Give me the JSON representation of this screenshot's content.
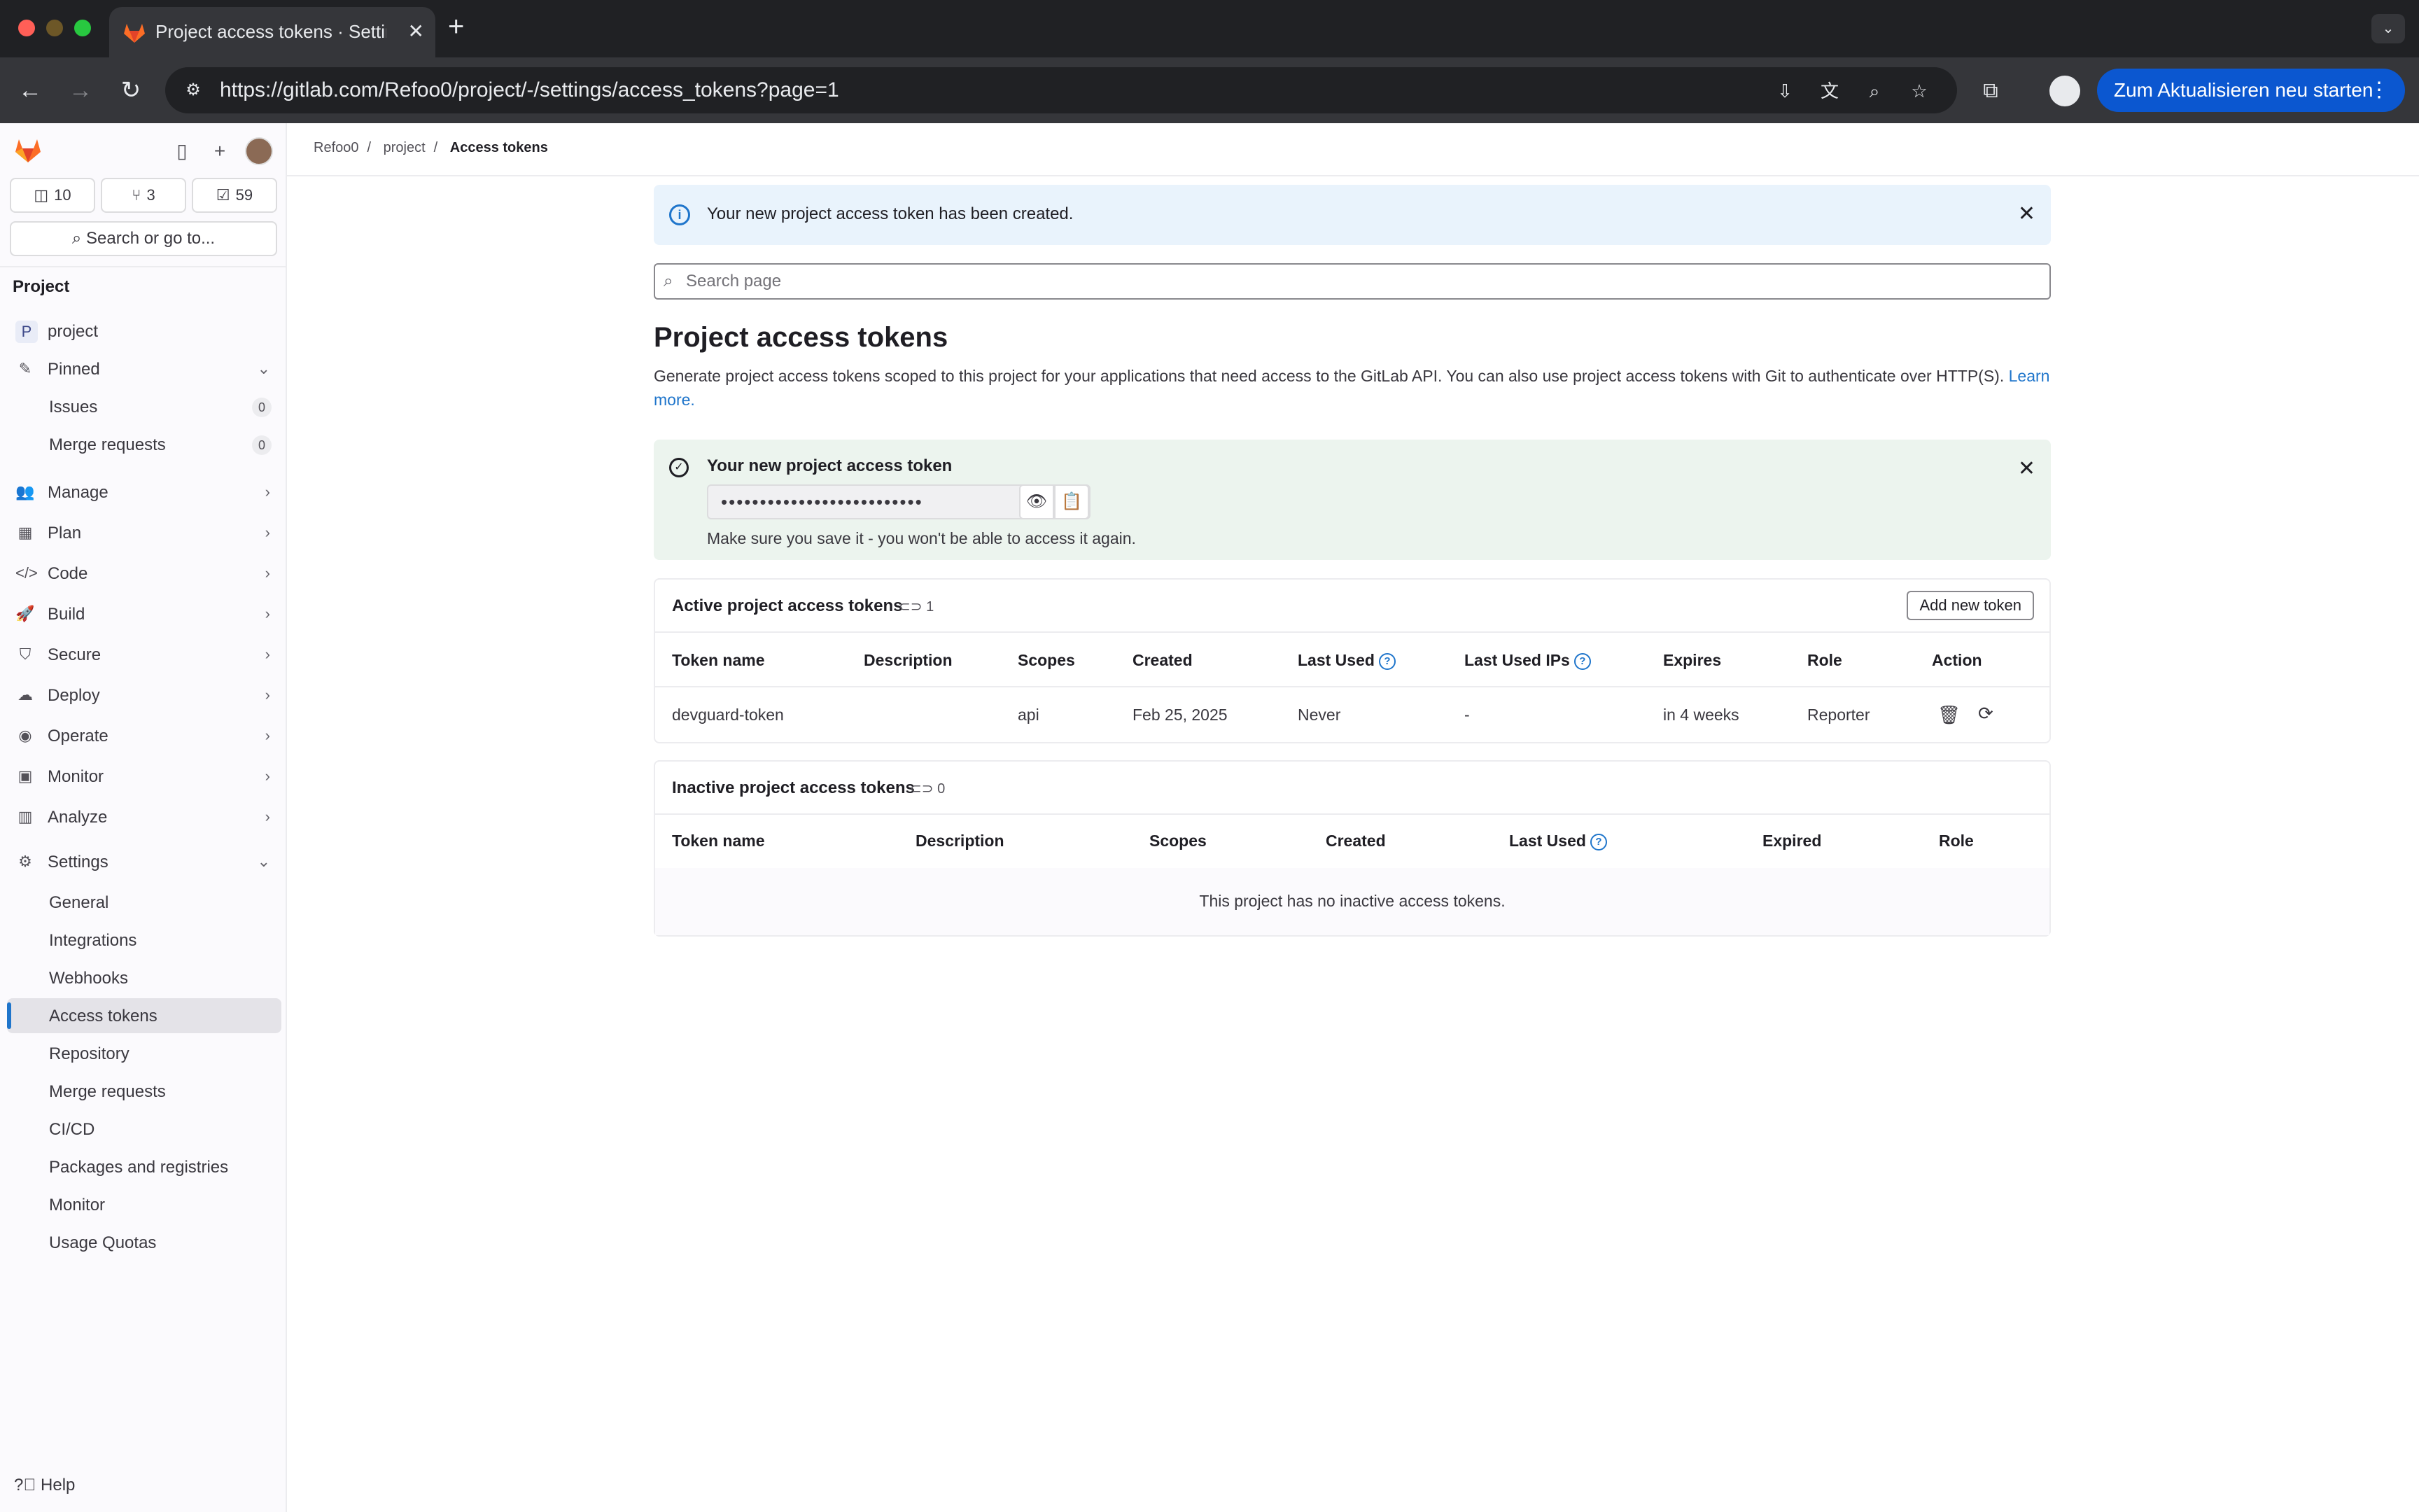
{
  "browser": {
    "tab_title": "Project access tokens · Settings",
    "tab_close": "✕",
    "new_tab": "+",
    "url": "https://gitlab.com/Refoo0/project/-/settings/access_tokens?page=1",
    "update_button": "Zum Aktualisieren neu starten",
    "menu": "⋮"
  },
  "sidebar": {
    "counters": {
      "issues": "10",
      "merge_requests": "3",
      "todos": "59"
    },
    "search_label": "Search or go to...",
    "heading": "Project",
    "project_initial": "P",
    "project_name": "project",
    "pinned": "Pinned",
    "pinned_items": [
      {
        "label": "Issues",
        "count": "0"
      },
      {
        "label": "Merge requests",
        "count": "0"
      }
    ],
    "nav": [
      {
        "label": "Manage",
        "icon": "manage-icon"
      },
      {
        "label": "Plan",
        "icon": "plan-icon"
      },
      {
        "label": "Code",
        "icon": "code-icon"
      },
      {
        "label": "Build",
        "icon": "build-icon"
      },
      {
        "label": "Secure",
        "icon": "shield-icon"
      },
      {
        "label": "Deploy",
        "icon": "deploy-icon"
      },
      {
        "label": "Operate",
        "icon": "operate-icon"
      },
      {
        "label": "Monitor",
        "icon": "monitor-icon"
      },
      {
        "label": "Analyze",
        "icon": "chart-icon"
      }
    ],
    "settings": "Settings",
    "settings_items": [
      "General",
      "Integrations",
      "Webhooks",
      "Access tokens",
      "Repository",
      "Merge requests",
      "CI/CD",
      "Packages and registries",
      "Monitor",
      "Usage Quotas"
    ],
    "active_item": "Access tokens",
    "help": "Help"
  },
  "breadcrumb": [
    "Refoo0",
    "project",
    "Access tokens"
  ],
  "info_alert": "Your new project access token has been created.",
  "search": {
    "placeholder": "Search page"
  },
  "page": {
    "title": "Project access tokens",
    "description": "Generate project access tokens scoped to this project for your applications that need access to the GitLab API. You can also use project access tokens with Git to authenticate over HTTP(S).",
    "learn_more": "Learn more."
  },
  "new_token": {
    "title": "Your new project access token",
    "masked_value": "••••••••••••••••••••••••••",
    "note": "Make sure you save it - you won't be able to access it again."
  },
  "active_tokens": {
    "title": "Active project access tokens",
    "count": "1",
    "add_button": "Add new token",
    "columns": [
      "Token name",
      "Description",
      "Scopes",
      "Created",
      "Last Used",
      "Last Used IPs",
      "Expires",
      "Role",
      "Action"
    ],
    "rows": [
      {
        "name": "devguard-token",
        "description": "",
        "scopes": "api",
        "created": "Feb 25, 2025",
        "last_used": "Never",
        "last_used_ips": "-",
        "expires": "in 4 weeks",
        "role": "Reporter"
      }
    ]
  },
  "inactive_tokens": {
    "title": "Inactive project access tokens",
    "count": "0",
    "columns": [
      "Token name",
      "Description",
      "Scopes",
      "Created",
      "Last Used",
      "Expired",
      "Role"
    ],
    "empty": "This project has no inactive access tokens."
  },
  "colors": {
    "accent": "#1f75cb",
    "brand": "#fc6d26",
    "update_button": "#0b57d0",
    "success_bg": "#ecf4ee",
    "info_bg": "#e9f3fc"
  }
}
